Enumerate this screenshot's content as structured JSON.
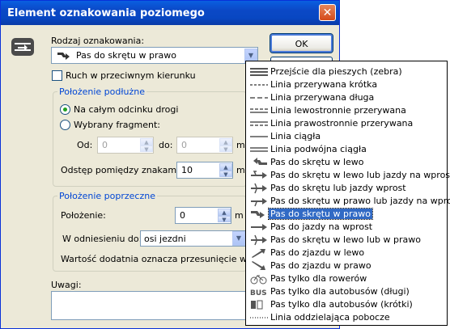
{
  "window": {
    "title": "Element oznakowania poziomego"
  },
  "marking_type": {
    "label": "Rodzaj oznakowania:",
    "selected": "Pas do skrętu w prawo"
  },
  "buttons": {
    "ok": "OK"
  },
  "reverse_traffic": {
    "label": "Ruch w przeciwnym kierunku",
    "checked": false
  },
  "longitudinal": {
    "title": "Położenie podłużne",
    "option_whole": "Na całym odcinku drogi",
    "option_fragment": "Wybrany fragment:",
    "selected": "whole",
    "from_label": "Od:",
    "from_value": "0",
    "to_label": "do:",
    "to_value": "0",
    "spacing_label": "Odstęp pomiędzy znakami:",
    "spacing_value": "10",
    "unit": "m"
  },
  "transverse": {
    "title": "Położenie poprzeczne",
    "position_label": "Położenie:",
    "position_value": "0",
    "unit": "m",
    "relative_label": "W odniesieniu do:",
    "relative_value": "osi jezdni",
    "note": "Wartość dodatnia oznacza przesunięcie w praw"
  },
  "notes": {
    "label": "Uwagi:"
  },
  "dropdown": {
    "items": [
      {
        "label": "Przejście dla pieszych (zebra)",
        "icon": "zebra-icon"
      },
      {
        "label": "Linia przerywana krótka",
        "icon": "short-dashed-line-icon"
      },
      {
        "label": "Linia przerywana długa",
        "icon": "long-dashed-line-icon"
      },
      {
        "label": "Linia lewostronnie przerywana",
        "icon": "left-dashed-line-icon"
      },
      {
        "label": "Linia prawostronnie przerywana",
        "icon": "right-dashed-line-icon"
      },
      {
        "label": "Linia ciągła",
        "icon": "solid-line-icon"
      },
      {
        "label": "Linia podwójna ciągła",
        "icon": "double-solid-line-icon"
      },
      {
        "label": "Pas do skrętu w lewo",
        "icon": "turn-left-arrow-icon"
      },
      {
        "label": "Pas do skrętu w lewo lub jazdy na wprost",
        "icon": "left-or-straight-arrow-icon"
      },
      {
        "label": "Pas do skrętu lub jazdy wprost",
        "icon": "turn-or-straight-arrow-icon"
      },
      {
        "label": "Pas do skrętu w prawo lub jazdy na wprost",
        "icon": "right-or-straight-arrow-icon"
      },
      {
        "label": "Pas do skrętu w prawo",
        "icon": "turn-right-arrow-icon",
        "selected": true
      },
      {
        "label": "Pas do jazdy na wprost",
        "icon": "straight-arrow-icon"
      },
      {
        "label": "Pas do skrętu w lewo lub w prawo",
        "icon": "left-or-right-arrow-icon"
      },
      {
        "label": "Pas do zjazdu w lewo",
        "icon": "exit-left-arrow-icon"
      },
      {
        "label": "Pas do zjazdu w prawo",
        "icon": "exit-right-arrow-icon"
      },
      {
        "label": "Pas tylko dla rowerów",
        "icon": "bicycle-icon"
      },
      {
        "label": "Pas tylko dla autobusów (długi)",
        "icon": "bus-long-icon"
      },
      {
        "label": "Pas tylko dla autobusów (krótki)",
        "icon": "bus-short-icon"
      },
      {
        "label": "Linia oddzielająca pobocze",
        "icon": "dotted-line-icon"
      }
    ]
  }
}
